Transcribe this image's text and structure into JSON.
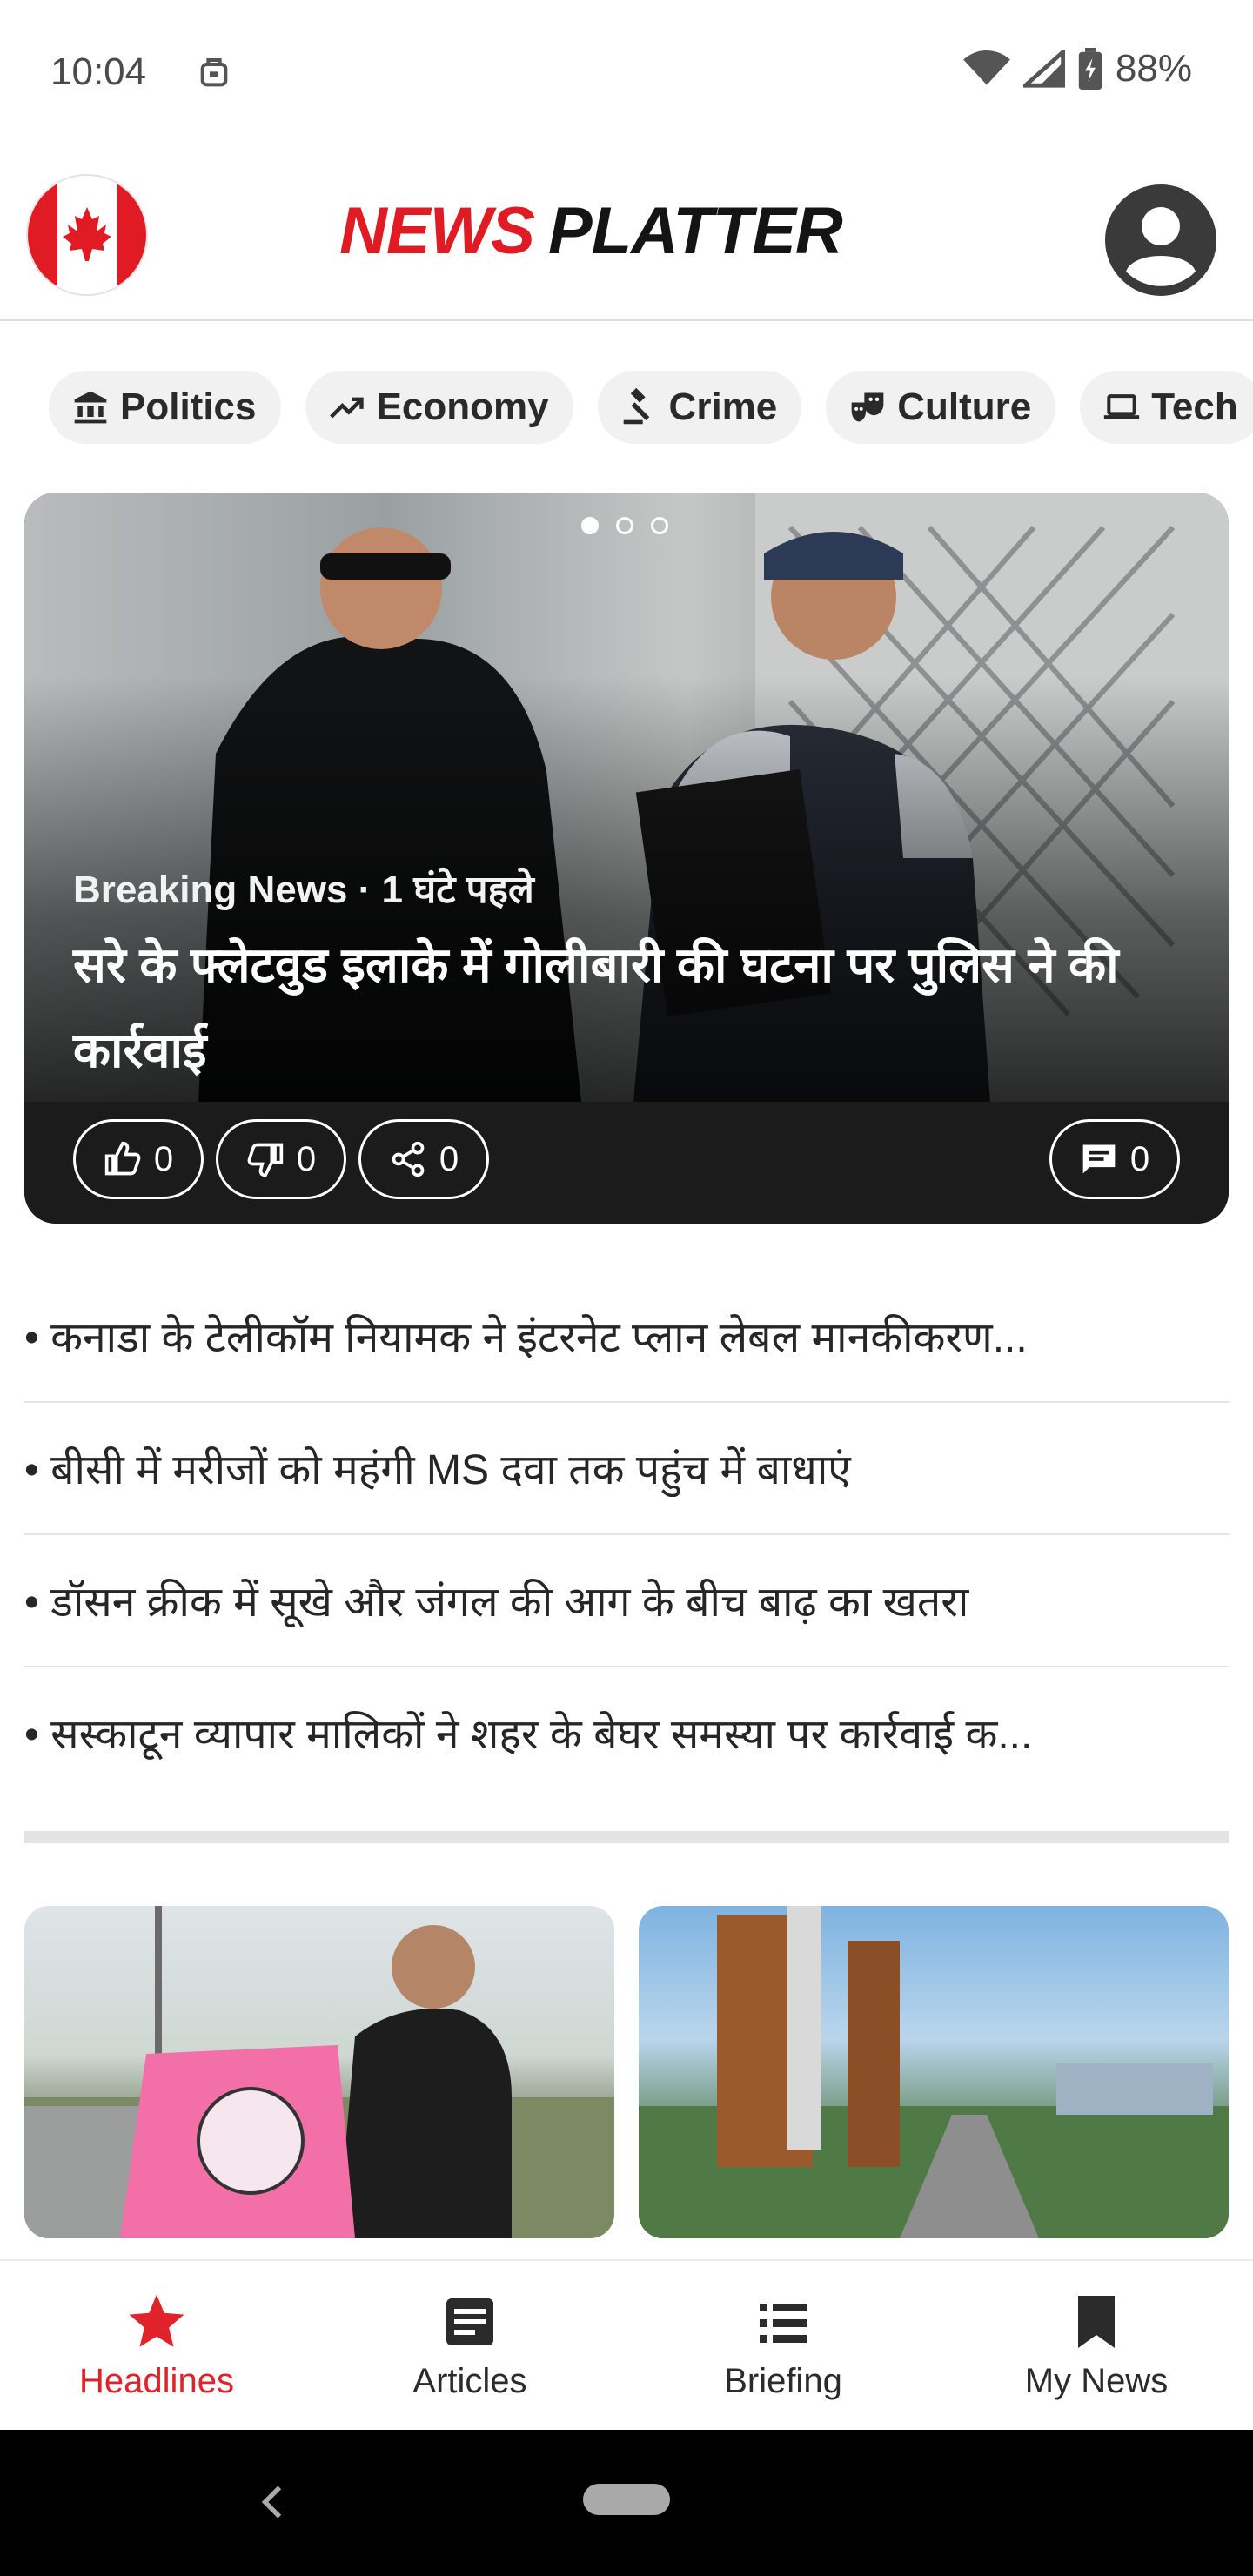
{
  "status_bar": {
    "time": "10:04",
    "battery": "88%"
  },
  "header": {
    "logo_part1": "NEWS",
    "logo_part2": "PLATTER"
  },
  "categories": [
    {
      "label": "Politics",
      "icon": "bank-icon"
    },
    {
      "label": "Economy",
      "icon": "trending-up-icon"
    },
    {
      "label": "Crime",
      "icon": "gavel-icon"
    },
    {
      "label": "Culture",
      "icon": "theater-masks-icon"
    },
    {
      "label": "Tech",
      "icon": "laptop-icon"
    }
  ],
  "hero": {
    "meta": "Breaking News · 1 घंटे पहले",
    "title": "सरे के फ्लेटवुड इलाके में गोलीबारी की घटना पर पुलिस ने की कार्रवाई",
    "likes": "0",
    "dislikes": "0",
    "shares": "0",
    "comments": "0",
    "carousel_pages": 3,
    "carousel_active": 1
  },
  "headlines": [
    "• कनाडा के टेलीकॉम नियामक ने इंटरनेट प्लान लेबल मानकीकरण...",
    "• बीसी में मरीजों को महंगी MS दवा तक पहुंच में बाधाएं",
    "• डॉसन क्रीक में सूखे और जंगल की आग के बीच बाढ़ का खतरा",
    "• सस्काटून व्यापार मालिकों ने शहर के बेघर समस्या पर कार्रवाई क..."
  ],
  "bottom_nav": [
    {
      "label": "Headlines",
      "icon": "star-icon",
      "active": true
    },
    {
      "label": "Articles",
      "icon": "article-icon",
      "active": false
    },
    {
      "label": "Briefing",
      "icon": "list-icon",
      "active": false
    },
    {
      "label": "My News",
      "icon": "bookmark-icon",
      "active": false
    }
  ],
  "colors": {
    "accent": "#e0222b",
    "card_dark": "#1b1b1b",
    "chip_bg": "#f1f1f1"
  }
}
